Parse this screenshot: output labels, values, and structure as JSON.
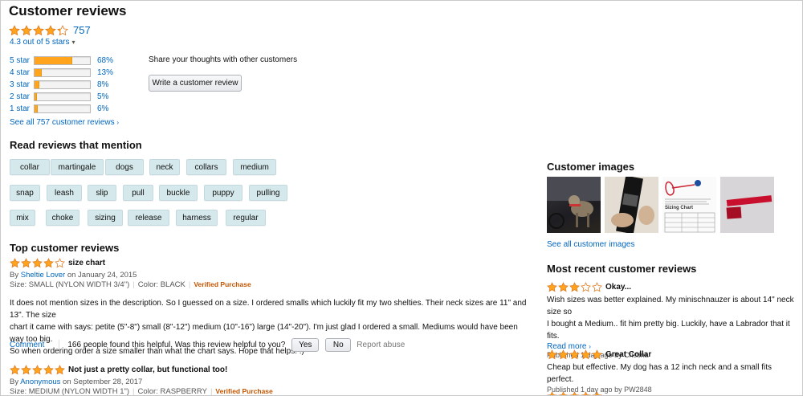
{
  "header": {
    "title": "Customer reviews"
  },
  "rating": {
    "stars": 4.3,
    "count": "757",
    "out_of": "4.3 out of 5 stars"
  },
  "histogram": [
    {
      "label": "5 star",
      "pct": "68%",
      "value": 0.68
    },
    {
      "label": "4 star",
      "pct": "13%",
      "value": 0.13
    },
    {
      "label": "3 star",
      "pct": "8%",
      "value": 0.08
    },
    {
      "label": "2 star",
      "pct": "5%",
      "value": 0.05
    },
    {
      "label": "1 star",
      "pct": "6%",
      "value": 0.06
    }
  ],
  "see_all": "See all 757 customer reviews",
  "share": {
    "text": "Share your thoughts with other customers",
    "button": "Write a customer review"
  },
  "mentions": {
    "title": "Read reviews that mention",
    "chips": [
      "collar",
      "martingale",
      "dogs",
      "neck",
      "collars",
      "medium",
      "snap",
      "leash",
      "slip",
      "pull",
      "buckle",
      "puppy",
      "pulling",
      "mix",
      "choke",
      "sizing",
      "release",
      "harness",
      "regular"
    ]
  },
  "top_reviews": {
    "title": "Top customer reviews",
    "items": [
      {
        "stars": 4,
        "title": "size chart",
        "by": "By",
        "author": "Sheltie Lover",
        "date": "on January 24, 2015",
        "size": "Size: SMALL (NYLON WIDTH 3/4\")",
        "color": "Color: BLACK",
        "verified": "Verified Purchase",
        "lines": [
          "It does not mention sizes in the description. So I guessed on a size. I ordered smalls which luckily fit my two shelties. Their neck sizes are 11\" and 13\". The size",
          "chart it came with says: petite (5\"-8\") small (8\"-12\") medium (10\"-16\") large (14\"-20\"). I'm just glad I ordered a small. Mediums would have been way too big.",
          "So when ordering order a size smaller than what the chart says. Hope that helps. :)"
        ]
      },
      {
        "stars": 5,
        "title": "Not just a pretty collar, but functional too!",
        "by": "By",
        "author": "Anonymous",
        "date": "on September 28, 2017",
        "size": "Size: MEDIUM (NYLON WIDTH 1\")",
        "color": "Color: RASPBERRY",
        "verified": "Verified Purchase"
      }
    ]
  },
  "feedback": {
    "comment": "Comment",
    "helpful": "166 people found this helpful. Was this review helpful to you?",
    "yes": "Yes",
    "no": "No",
    "abuse": "Report abuse"
  },
  "customer_images": {
    "title": "Customer images",
    "see_all": "See all customer images",
    "chart_label": "Sizing Chart"
  },
  "recent": {
    "title": "Most recent customer reviews",
    "items": [
      {
        "stars": 3,
        "title": "Okay...",
        "lines": [
          "Wish sizes was better explained. My minischnauzer is about 14\" neck size so",
          "I bought a Medium.. fit him pretty big. Luckily, have a Labrador that it fits."
        ],
        "more": "Read more",
        "published": "Published 1 day ago by Cristina"
      },
      {
        "stars": 5,
        "title": "Great Collar",
        "lines": [
          "Cheap but effective. My dog has a 12 inch neck and a small fits perfect."
        ],
        "published": "Published 1 day ago by PW2848"
      }
    ]
  },
  "colors": {
    "star": "#ffa41c",
    "link": "#0066c0",
    "chip": "#d5e9ec",
    "verified": "#c45500"
  }
}
